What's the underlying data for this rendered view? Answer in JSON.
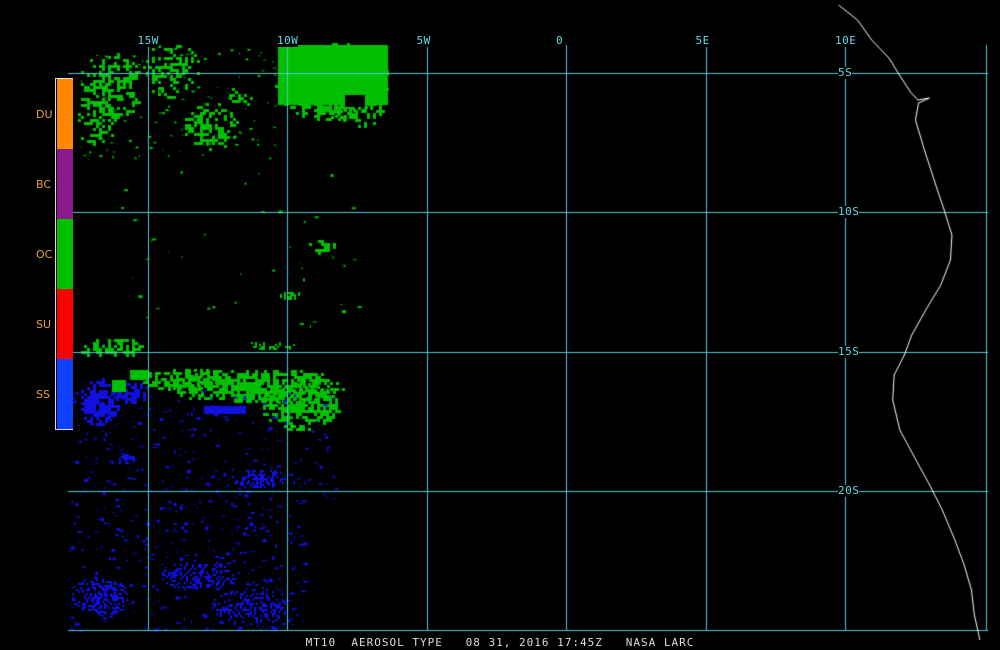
{
  "caption": "MT10  AEROSOL TYPE   08 31, 2016 17:45Z   NASA LARC",
  "longitude_labels": [
    {
      "text": "15W",
      "lon": -15
    },
    {
      "text": "10W",
      "lon": -10
    },
    {
      "text": "5W",
      "lon": -5
    },
    {
      "text": "0",
      "lon": 0
    },
    {
      "text": "5E",
      "lon": 5
    },
    {
      "text": "10E",
      "lon": 10
    }
  ],
  "latitude_labels": [
    {
      "text": "5S",
      "lat": -5
    },
    {
      "text": "10S",
      "lat": -10
    },
    {
      "text": "15S",
      "lat": -15
    },
    {
      "text": "20S",
      "lat": -20
    }
  ],
  "legend": [
    {
      "label": "DU",
      "color": "#ff8800"
    },
    {
      "label": "BC",
      "color": "#8a1a8a"
    },
    {
      "label": "OC",
      "color": "#00c000"
    },
    {
      "label": "SU",
      "color": "#ff0000"
    },
    {
      "label": "SS",
      "color": "#1040ff"
    }
  ],
  "colors": {
    "grid": "#4fc8d8",
    "coastline": "#ffffff",
    "background": "#000000",
    "oc_pixels": "#00c000",
    "ss_pixels": "#1010e0"
  }
}
